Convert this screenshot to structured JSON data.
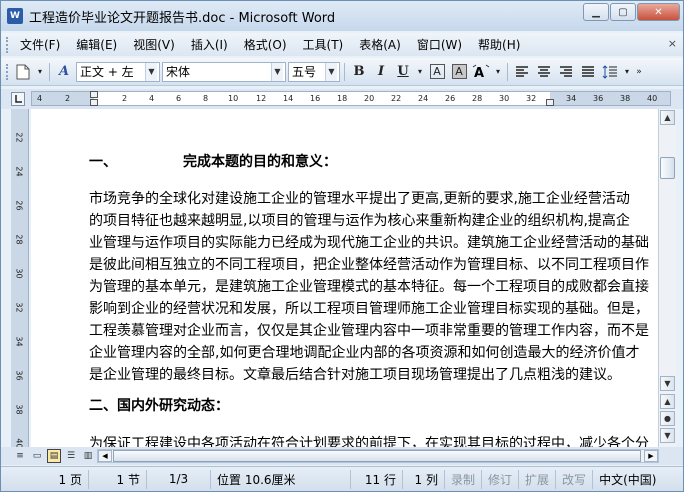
{
  "window": {
    "title": "工程造价毕业论文开题报告书.doc - Microsoft Word",
    "app_icon": "W",
    "minimize": "▁",
    "maximize": "▢",
    "close": "✕"
  },
  "menu": {
    "items": [
      "文件(F)",
      "编辑(E)",
      "视图(V)",
      "插入(I)",
      "格式(O)",
      "工具(T)",
      "表格(A)",
      "窗口(W)",
      "帮助(H)"
    ],
    "close_doc": "×"
  },
  "toolbar": {
    "style_value": "正文 + 左",
    "font_value": "宋体",
    "size_value": "五号",
    "bold": "B",
    "italic": "I",
    "underline": "U",
    "char_border": "A",
    "char_shade": "A"
  },
  "ruler": {
    "ticks": [
      "4",
      "2",
      "2",
      "4",
      "6",
      "8",
      "10",
      "12",
      "14",
      "16",
      "18",
      "20",
      "22",
      "24",
      "26",
      "28",
      "30",
      "32",
      "34",
      "36",
      "38",
      "40"
    ],
    "vticks": [
      "22",
      "24",
      "26",
      "28",
      "30",
      "32",
      "34",
      "36",
      "38",
      "40"
    ]
  },
  "document": {
    "heading1": "一、",
    "heading1_title": "完成本题的目的和意义：",
    "para1": [
      "市场竞争的全球化对建设施工企业的管理水平提出了更高,更新的要求,施工企业经营活动",
      "的项目特征也越来越明显,以项目的管理与运作为核心来重新构建企业的组织机构,提高企",
      "业管理与运作项目的实际能力已经成为现代施工企业的共识。建筑施工企业经营活动的基础",
      "是彼此间相互独立的不同工程项目，把企业整体经营活动作为管理目标、以不同工程项目作",
      "为管理的基本单元，是建筑施工企业管理模式的基本特征。每一个工程项目的成败都会直接",
      "影响到企业的经营状况和发展，所以工程项目管理师施工企业管理目标实现的基础。但是，",
      "工程羡慕管理对企业而言，仅仅是其企业管理内容中一项非常重要的管理工作内容，而不是",
      "企业管理内容的全部,如何更合理地调配企业内部的各项资源和如何创造最大的经济价值才",
      "是企业管理的最终目标。文章最后结合针对施工项目现场管理提出了几点粗浅的建议。"
    ],
    "heading2": "二、国内外研究动态：",
    "para2_first": "为保证工程建设中各项活动在符合计划要求的前提下，在实现其目标的过程中，减少各个分"
  },
  "status": {
    "page": "1 页",
    "section": "1 节",
    "page_of": "1/3",
    "position": "位置 10.6厘米",
    "line": "11 行",
    "column": "1 列",
    "rec": "录制",
    "trk": "修订",
    "ext": "扩展",
    "ovr": "改写",
    "language": "中文(中国)"
  }
}
